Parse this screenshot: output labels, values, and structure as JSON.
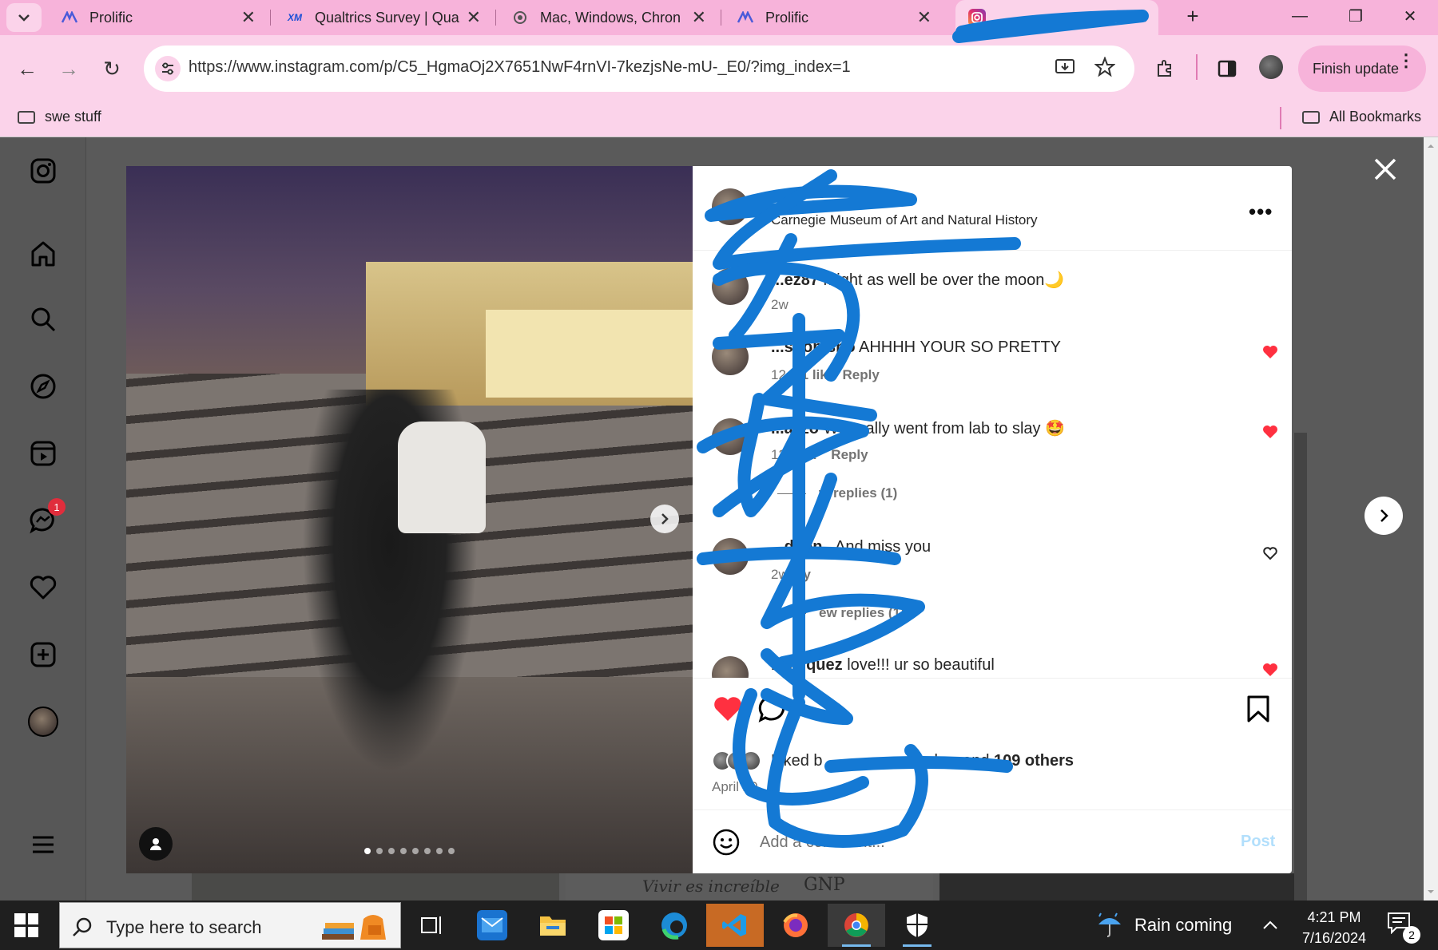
{
  "browser": {
    "tabs": [
      {
        "title": "Prolific",
        "favicon": "prolific-icon"
      },
      {
        "title": "Qualtrics Survey | Qua",
        "favicon": "qualtrics-icon"
      },
      {
        "title": "Mac, Windows, Chron",
        "favicon": "app-icon"
      },
      {
        "title": "Prolific",
        "favicon": "prolific-icon"
      },
      {
        "title": "",
        "favicon": "instagram-icon",
        "active": true
      }
    ],
    "new_tab": "+",
    "url": "https://www.instagram.com/p/C5_HgmaOj2X7651NwF4rnVI-7kezjsNe-mU-_E0/?img_index=1",
    "finish_update": "Finish update",
    "bookmarks": {
      "left": "swe stuff",
      "right": "All Bookmarks"
    },
    "accent": "#f7b3da"
  },
  "post": {
    "location": "Carnegie Museum of Art and Natural History",
    "image_count": 8,
    "current_image": 1,
    "comments": [
      {
        "user": "...ez87",
        "text": "might as well be over the moon🌙",
        "age": "2w",
        "likes": "",
        "reply": "",
        "liked": false,
        "heart": "none"
      },
      {
        "user": "...shop.sho",
        "text": "AHHHH YOUR SO PRETTY",
        "age": "12",
        "likes": "1 lik",
        "reply": "Reply",
        "liked": true,
        "heart": "filled"
      },
      {
        "user": "...azzo",
        "text": "We really went from lab to slay 🤩",
        "age": "12",
        "likes": "lik",
        "reply": "Reply",
        "liked": true,
        "heart": "filled",
        "view_replies": "w replies (1)"
      },
      {
        "user": "...dson_",
        "text": "And miss you",
        "age": "2w",
        "likes": "",
        "reply": "y",
        "liked": false,
        "heart": "outline",
        "view_replies": "ew replies (1)"
      },
      {
        "user": "my...quez",
        "text": "love!!! ur so beautiful",
        "age": "",
        "likes": "",
        "reply": "",
        "liked": true,
        "heart": "filled"
      }
    ],
    "liked_by_prefix": "Liked b",
    "liked_by_suffix": "low and ",
    "liked_by_count": "109 others",
    "date": "April 20",
    "comment_placeholder": "Add a comment...",
    "post_button": "Post",
    "like_color": "#ff3040"
  },
  "sidebar": {
    "icons": [
      "instagram-logo-icon",
      "home-icon",
      "search-icon",
      "explore-icon",
      "reels-icon",
      "messages-icon",
      "notifications-icon",
      "create-icon",
      "profile-avatar",
      "more-menu-icon"
    ],
    "messages_badge": "1"
  },
  "background_strip": {
    "text": "Vivir es increíble",
    "brand": "GNP"
  },
  "taskbar": {
    "search_placeholder": "Type here to search",
    "weather": "Rain coming",
    "time": "4:21 PM",
    "date": "7/16/2024",
    "notifications": "2"
  }
}
